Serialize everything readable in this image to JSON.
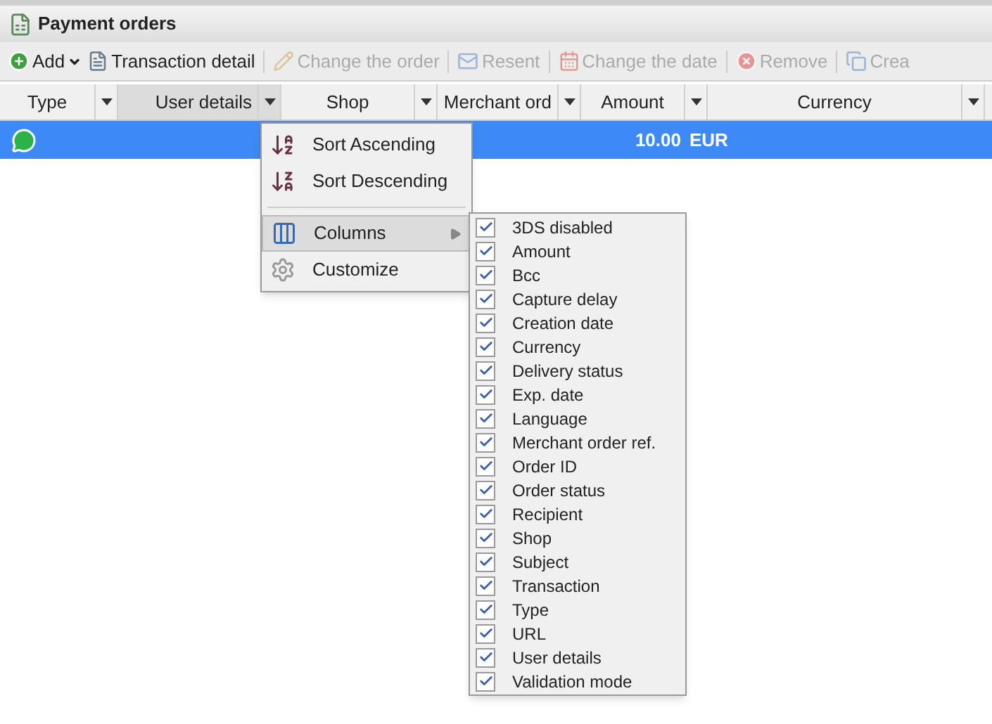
{
  "window": {
    "title": "Payment orders"
  },
  "toolbar": [
    {
      "label": "Add",
      "kind": "add",
      "disabled": false,
      "dropdown": true
    },
    {
      "label": "Transaction detail",
      "kind": "detail",
      "disabled": false,
      "dropdown": false
    },
    {
      "label": "Change the order",
      "kind": "edit",
      "disabled": true,
      "dropdown": false
    },
    {
      "label": "Resent",
      "kind": "mail",
      "disabled": true,
      "dropdown": false
    },
    {
      "label": "Change the date",
      "kind": "calendar",
      "disabled": true,
      "dropdown": false
    },
    {
      "label": "Remove",
      "kind": "remove",
      "disabled": true,
      "dropdown": false
    },
    {
      "label": "Crea",
      "kind": "copy",
      "disabled": true,
      "dropdown": false
    }
  ],
  "table": {
    "columns": [
      {
        "label": "Type",
        "active": false
      },
      {
        "label": "User details",
        "active": true
      },
      {
        "label": "Shop",
        "active": false
      },
      {
        "label": "Merchant ord",
        "active": false
      },
      {
        "label": "Amount",
        "active": false
      },
      {
        "label": "Currency",
        "active": false
      }
    ],
    "rows": [
      {
        "selected": true,
        "amount": "10.00",
        "currency": "EUR"
      }
    ]
  },
  "column_menu": {
    "items": [
      {
        "kind": "sort_asc",
        "label": "Sort Ascending"
      },
      {
        "kind": "sort_desc",
        "label": "Sort Descending"
      },
      {
        "kind": "separator"
      },
      {
        "kind": "columns",
        "label": "Columns",
        "expanded": true
      },
      {
        "kind": "customize",
        "label": "Customize"
      }
    ]
  },
  "columns_submenu": [
    {
      "label": "3DS disabled",
      "checked": true
    },
    {
      "label": "Amount",
      "checked": true
    },
    {
      "label": "Bcc",
      "checked": true
    },
    {
      "label": "Capture delay",
      "checked": true
    },
    {
      "label": "Creation date",
      "checked": true
    },
    {
      "label": "Currency",
      "checked": true
    },
    {
      "label": "Delivery status",
      "checked": true
    },
    {
      "label": "Exp. date",
      "checked": true
    },
    {
      "label": "Language",
      "checked": true
    },
    {
      "label": "Merchant order ref.",
      "checked": true
    },
    {
      "label": "Order ID",
      "checked": true
    },
    {
      "label": "Order status",
      "checked": true
    },
    {
      "label": "Recipient",
      "checked": true
    },
    {
      "label": "Shop",
      "checked": true
    },
    {
      "label": "Subject",
      "checked": true
    },
    {
      "label": "Transaction",
      "checked": true
    },
    {
      "label": "Type",
      "checked": true
    },
    {
      "label": "URL",
      "checked": true
    },
    {
      "label": "User details",
      "checked": true
    },
    {
      "label": "Validation mode",
      "checked": true
    }
  ]
}
